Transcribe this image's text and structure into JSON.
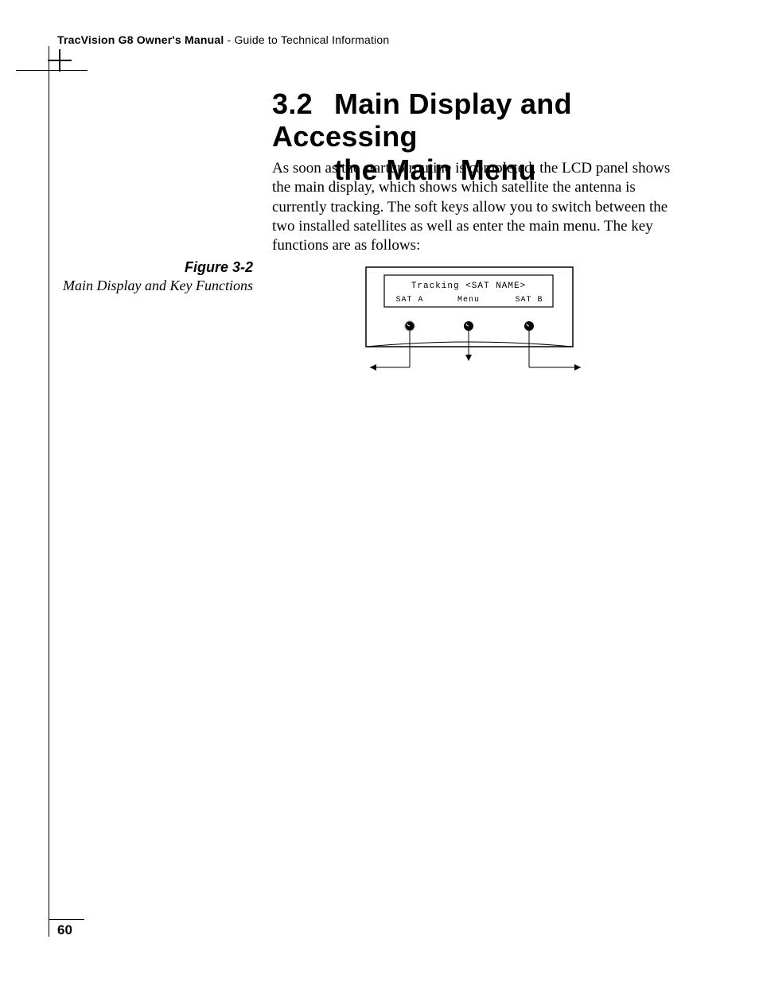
{
  "header": {
    "manual_title_bold": "TracVision G8 Owner's Manual",
    "separator": " - ",
    "subtitle": "Guide to Technical Information"
  },
  "section": {
    "number": "3.2",
    "title_line1": "Main Display and Accessing",
    "title_line2": "the Main Menu"
  },
  "paragraph": "As soon as the startup routine is completed, the LCD panel shows the main display, which shows which satellite the antenna is currently tracking. The soft keys allow you to switch between the two installed satellites as well as enter the main menu. The key functions are as follows:",
  "figure": {
    "label": "Figure 3-2",
    "description": "Main Display and Key Functions",
    "lcd_line1": "Tracking <SAT NAME>",
    "softkey_left": "SAT A",
    "softkey_center": "Menu",
    "softkey_right": "SAT B"
  },
  "page_number": "60"
}
